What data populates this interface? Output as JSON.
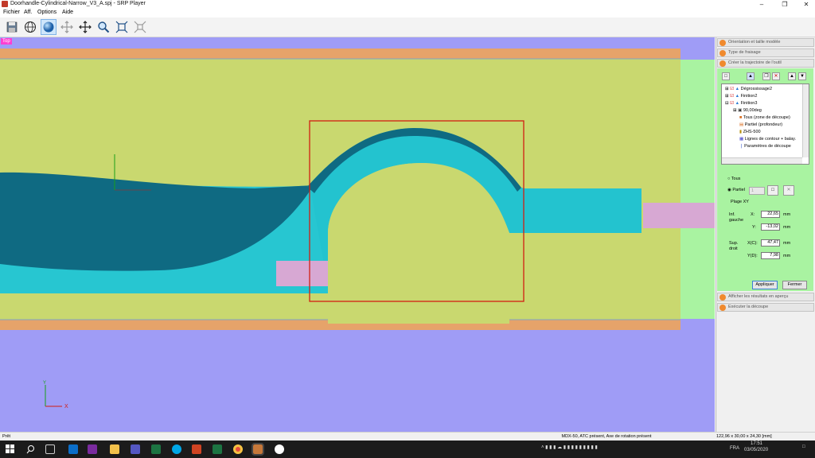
{
  "window": {
    "title": "Doorhandle-Cylindrical-Narrow_V3_A.spj - SRP Player",
    "minimize_icon": "minimize-icon",
    "maximize_icon": "restore-icon",
    "close_icon": "close-icon"
  },
  "menu": [
    "Fichier",
    "Aff.",
    "Options",
    "Aide"
  ],
  "toolbar": {
    "buttons": [
      "save-icon",
      "globe-wireframe-icon",
      "sphere-shaded-icon",
      "move-arrows-icon",
      "pan-icon",
      "zoom-icon",
      "zoom-fit-icon",
      "zoom-all-icon"
    ],
    "active": "sphere-shaded-icon"
  },
  "viewport": {
    "view_label": "Top",
    "colors": {
      "stock": "#c9d86f",
      "lower_bg": "#9f9cf6",
      "green_bg": "#a9f3a1",
      "border_band": "#e6a36a",
      "selection": "#d21e12",
      "part_cyan": "#23c3cf",
      "part_dark": "#0f6a82",
      "pink": "#d7a8d3"
    }
  },
  "panel": {
    "sections_top": [
      "Orientation et taille modèle",
      "Type de fraisage",
      "Créer la trajectoire de l'outil"
    ],
    "tree": [
      {
        "label": "Dégrossissage2"
      },
      {
        "label": "Finition2"
      },
      {
        "label": "Finition3"
      },
      {
        "label": "90,00deg"
      },
      {
        "label": "Tous (zone de découpe)"
      },
      {
        "label": "Partiel (profondeur)"
      },
      {
        "label": "ZHS-500"
      },
      {
        "label": "Lignes de contour + balay."
      },
      {
        "label": "Paramètres de découpe"
      }
    ],
    "range": {
      "option_all": "Tous",
      "option_partial": "Partiel",
      "partial_value": "1",
      "plage_label": "Plage XY",
      "inf_label": "Inf.\ngauche",
      "sup_label": "Sup.\ndroit",
      "x_label": "X:",
      "y_label": "Y:",
      "xc_label": "X(C):",
      "yd_label": "Y(D):",
      "x_value": "22,65",
      "y_value": "-13,02",
      "xc_value": "47,47",
      "yd_value": "7,98",
      "unit": "mm"
    },
    "apply_label": "Appliquer",
    "close_label": "Fermer",
    "sections_bottom": [
      "Afficher les résultats en aperçu",
      "Exécuter la découpe"
    ]
  },
  "status": {
    "left": "Prêt",
    "machine": "MDX-50, ATC présent, Axe de rotation présent",
    "size": "122,96 x 30,00 x 24,30 [mm]"
  },
  "taskbar": {
    "lang": "FRA",
    "time": "17:51",
    "date": "03/05/2020",
    "apps": [
      "windows-start-icon",
      "search-icon",
      "task-view-icon",
      "outlook-icon",
      "onenote-icon",
      "file-explorer-icon",
      "teams-icon",
      "excel-icon",
      "skype-icon",
      "powerpoint-icon",
      "excel-icon",
      "chrome-icon",
      "srp-player-icon",
      "vpanel-icon"
    ]
  }
}
